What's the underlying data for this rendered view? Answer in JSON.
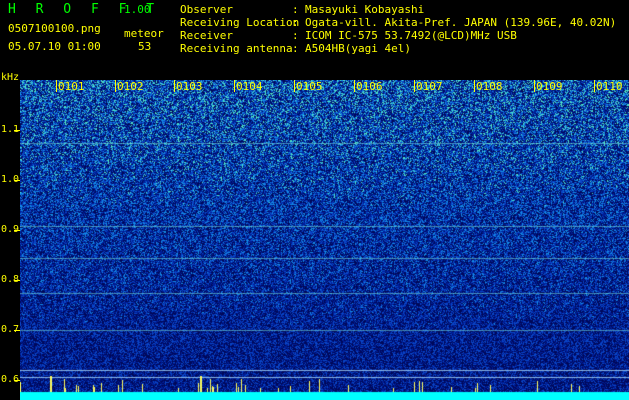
{
  "header": {
    "title": "H R O F F T",
    "version": "1.00",
    "filename": "0507100100.png",
    "datetime": "05.07.10 01:00",
    "meteor_label": "meteor",
    "meteor_count": "53"
  },
  "info": [
    {
      "label": "Observer",
      "sep": ":",
      "value": "Masayuki Kobayashi"
    },
    {
      "label": "Receiving Location",
      "sep": ":",
      "value": "Ogata-vill. Akita-Pref. JAPAN (139.96E, 40.02N)"
    },
    {
      "label": "Receiver",
      "sep": ":",
      "value": "ICOM IC-575 53.7492(@LCD)MHz USB"
    },
    {
      "label": "Receiving antenna",
      "sep": ":",
      "value": "A504HB(yagi 4el)"
    }
  ],
  "spectrogram": {
    "y_unit": "kHz",
    "y_ticks": [
      "1.1",
      "1.0",
      "0.9",
      "0.8",
      "0.7",
      "0.6"
    ],
    "time_ticks": [
      "0101",
      "0102",
      "0103",
      "0104",
      "0105",
      "0106",
      "0107",
      "0108",
      "0109",
      "0110"
    ],
    "colors": {
      "text": "#ffff00",
      "header_text": "#00ff00",
      "background": "#000000",
      "noise_low": "#0010a0",
      "noise_high": "#40e0ff"
    }
  }
}
